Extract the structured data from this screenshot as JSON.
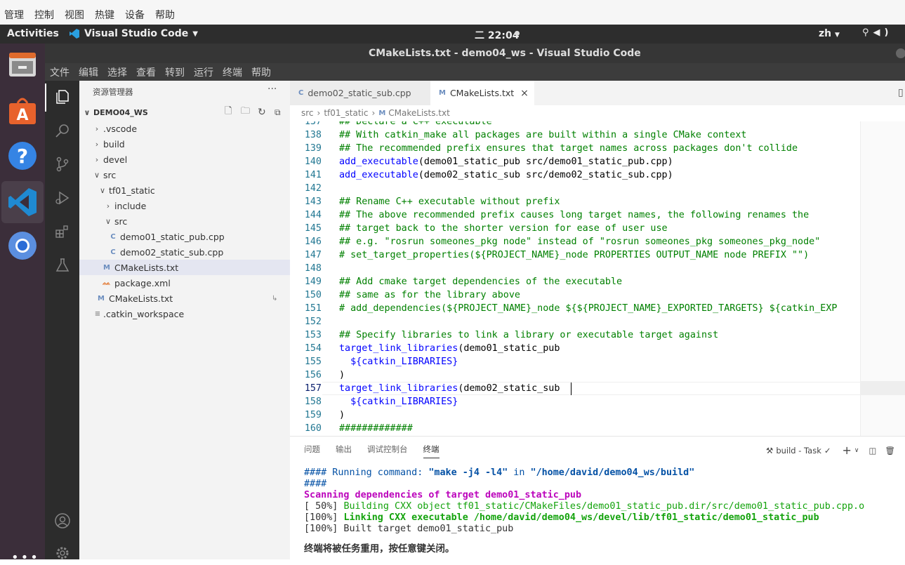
{
  "host_menu": [
    "管理",
    "控制",
    "视图",
    "热键",
    "设备",
    "帮助"
  ],
  "topbar": {
    "activities": "Activities",
    "app": "Visual Studio Code",
    "clock": "二 22:04",
    "lang": "zh"
  },
  "window_title": "CMakeLists.txt - demo04_ws - Visual Studio Code",
  "menubar": [
    "文件",
    "编辑",
    "选择",
    "查看",
    "转到",
    "运行",
    "终端",
    "帮助"
  ],
  "sidebar": {
    "header": "资源管理器",
    "root": "DEMO04_WS",
    "tree": [
      {
        "label": ".vscode",
        "kind": "folder"
      },
      {
        "label": "build",
        "kind": "folder"
      },
      {
        "label": "devel",
        "kind": "folder"
      },
      {
        "label": "src",
        "kind": "folder-open"
      },
      {
        "label": "tf01_static",
        "kind": "folder-open"
      },
      {
        "label": "include",
        "kind": "folder"
      },
      {
        "label": "src",
        "kind": "folder-open"
      },
      {
        "label": "demo01_static_pub.cpp",
        "kind": "cpp"
      },
      {
        "label": "demo02_static_sub.cpp",
        "kind": "cpp"
      },
      {
        "label": "CMakeLists.txt",
        "kind": "cmake"
      },
      {
        "label": "package.xml",
        "kind": "xml"
      },
      {
        "label": "CMakeLists.txt",
        "kind": "cmake"
      },
      {
        "label": ".catkin_workspace",
        "kind": "file"
      }
    ]
  },
  "tabs": [
    {
      "label": "demo02_static_sub.cpp"
    },
    {
      "label": "CMakeLists.txt",
      "close": "×"
    }
  ],
  "breadcrumb": [
    "src",
    "tf01_static",
    "CMakeLists.txt"
  ],
  "code": [
    {
      "n": "137",
      "t": "## Declare a C++ executable"
    },
    {
      "n": "138",
      "t": "## With catkin_make all packages are built within a single CMake context"
    },
    {
      "n": "139",
      "t": "## The recommended prefix ensures that target names across packages don't collide"
    },
    {
      "n": "140",
      "t": "add_executable(demo01_static_pub src/demo01_static_pub.cpp)"
    },
    {
      "n": "141",
      "t": "add_executable(demo02_static_sub src/demo02_static_sub.cpp)"
    },
    {
      "n": "142",
      "t": ""
    },
    {
      "n": "143",
      "t": "## Rename C++ executable without prefix"
    },
    {
      "n": "144",
      "t": "## The above recommended prefix causes long target names, the following renames the"
    },
    {
      "n": "145",
      "t": "## target back to the shorter version for ease of user use"
    },
    {
      "n": "146",
      "t": "## e.g. \"rosrun someones_pkg node\" instead of \"rosrun someones_pkg someones_pkg_node\""
    },
    {
      "n": "147",
      "t": "# set_target_properties(${PROJECT_NAME}_node PROPERTIES OUTPUT_NAME node PREFIX \"\")"
    },
    {
      "n": "148",
      "t": ""
    },
    {
      "n": "149",
      "t": "## Add cmake target dependencies of the executable"
    },
    {
      "n": "150",
      "t": "## same as for the library above"
    },
    {
      "n": "151",
      "t": "# add_dependencies(${PROJECT_NAME}_node ${${PROJECT_NAME}_EXPORTED_TARGETS} ${catkin_EXP"
    },
    {
      "n": "152",
      "t": ""
    },
    {
      "n": "153",
      "t": "## Specify libraries to link a library or executable target against"
    },
    {
      "n": "154",
      "t": "target_link_libraries(demo01_static_pub"
    },
    {
      "n": "155",
      "t": "  ${catkin_LIBRARIES}"
    },
    {
      "n": "156",
      "t": ")"
    },
    {
      "n": "157",
      "t": "target_link_libraries(demo02_static_sub"
    },
    {
      "n": "158",
      "t": "  ${catkin_LIBRARIES}"
    },
    {
      "n": "159",
      "t": ")"
    },
    {
      "n": "160",
      "t": "#############"
    }
  ],
  "panel": {
    "tabs": [
      "问题",
      "输出",
      "调试控制台",
      "终端"
    ],
    "task": "build - Task",
    "term": {
      "l1a": "#### Running command: ",
      "l1b": "\"make -j4 -l4\"",
      "l1c": " in ",
      "l1d": "\"/home/david/demo04_ws/build\"",
      "l2": "####",
      "l3": "Scanning dependencies of target demo01_static_pub",
      "l4a": "[ 50%] ",
      "l4b": "Building CXX object tf01_static/CMakeFiles/demo01_static_pub.dir/src/demo01_static_pub.cpp.o",
      "l5a": "[100%] ",
      "l5b": "Linking CXX executable /home/david/demo04_ws/devel/lib/tf01_static/demo01_static_pub",
      "l6": "[100%] Built target demo01_static_pub",
      "l7": "终端将被任务重用，按任意键关闭。"
    }
  }
}
